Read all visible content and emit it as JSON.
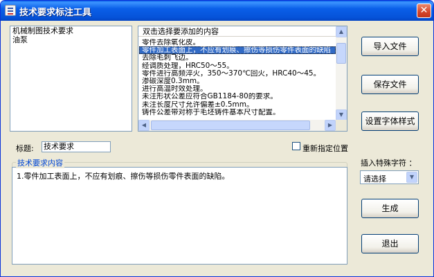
{
  "window": {
    "title": "技术要求标注工具",
    "close_glyph": "✕"
  },
  "left_list": {
    "items": [
      "机械制图技术要求",
      "油泵"
    ]
  },
  "right_list": {
    "header": "双击选择要添加的内容",
    "rows": [
      "零件去除氧化皮。",
      "零件加工表面上，不应有划痕、擦伤等损伤零件表面的缺陷",
      "去除毛刺飞边。",
      "经调质处理，HRC50～55。",
      "零件进行高频淬火，350～370℃回火，HRC40～45。",
      "渗碳深度0.3mm。",
      "进行高温时效处理。",
      "未注形状公差应符合GB1184-80的要求。",
      "未注长度尺寸允许偏差±0.5mm。",
      "铸件公差带对称于毛坯铸件基本尺寸配置。"
    ],
    "selected_index": 1
  },
  "buttons": {
    "import": "导入文件",
    "save": "保存文件",
    "font_style": "设置字体样式",
    "generate": "生成",
    "exit": "退出"
  },
  "title_field": {
    "label": "标题:",
    "value": "技术要求"
  },
  "reposition": {
    "label": "重新指定位置",
    "checked": false
  },
  "content_group": {
    "label": "技术要求内容",
    "text": "1.零件加工表面上，不应有划痕、擦伤等损伤零件表面的缺陷。"
  },
  "special_char": {
    "label": "插入特殊字符 ：",
    "selected": "请选择"
  },
  "icons": {
    "scroll_up": "▲",
    "scroll_down": "▼",
    "scroll_left": "◀",
    "scroll_right": "▶",
    "dropdown": "▼"
  }
}
